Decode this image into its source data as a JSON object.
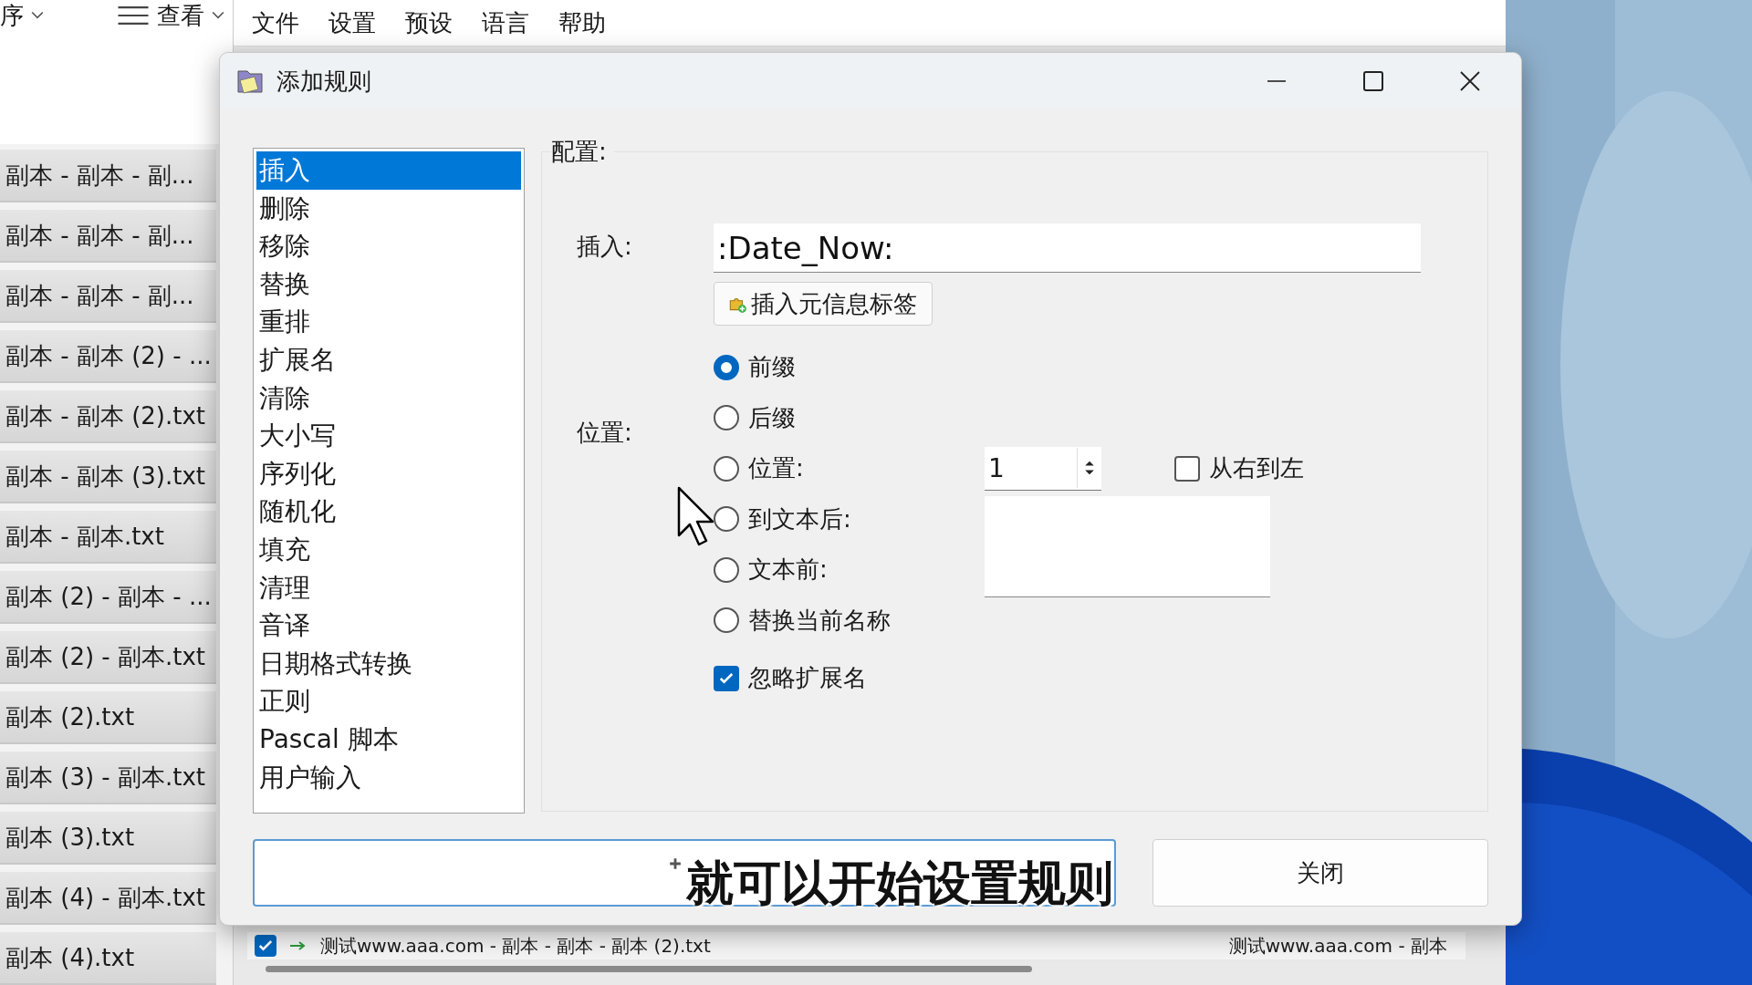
{
  "explorer": {
    "sort_label": "序",
    "view_label": "查看",
    "files": [
      "副本 - 副本 - 副...",
      "副本 - 副本 - 副...",
      "副本 - 副本 - 副...",
      "副本 - 副本 (2) - ...",
      "副本 - 副本 (2).txt",
      "副本 - 副本 (3).txt",
      "副本 - 副本.txt",
      "副本 (2) - 副本 - ...",
      "副本 (2) - 副本.txt",
      "副本 (2).txt",
      "副本 (3) - 副本.txt",
      "副本 (3).txt",
      "副本 (4) - 副本.txt",
      "副本 (4).txt"
    ]
  },
  "menu": [
    "文件",
    "设置",
    "预设",
    "语言",
    "帮助"
  ],
  "dialog": {
    "title": "添加规则",
    "rules": [
      {
        "label": "插入",
        "selected": true
      },
      {
        "label": "删除",
        "selected": false
      },
      {
        "label": "移除",
        "selected": false
      },
      {
        "label": "替换",
        "selected": false
      },
      {
        "label": "重排",
        "selected": false
      },
      {
        "label": "扩展名",
        "selected": false
      },
      {
        "label": "清除",
        "selected": false
      },
      {
        "label": "大小写",
        "selected": false
      },
      {
        "label": "序列化",
        "selected": false
      },
      {
        "label": "随机化",
        "selected": false
      },
      {
        "label": "填充",
        "selected": false
      },
      {
        "label": "清理",
        "selected": false
      },
      {
        "label": "音译",
        "selected": false
      },
      {
        "label": "日期格式转换",
        "selected": false
      },
      {
        "label": "正则",
        "selected": false
      },
      {
        "label": "Pascal 脚本",
        "selected": false
      },
      {
        "label": "用户输入",
        "selected": false
      }
    ],
    "config_label": "配置:",
    "insert_label": "插入:",
    "insert_value": ":Date_Now:",
    "meta_button": "插入元信息标签",
    "position_label": "位置:",
    "options": [
      {
        "kind": "plain",
        "label": "前缀",
        "selected": true
      },
      {
        "kind": "plain",
        "label": "后缀",
        "selected": false
      },
      {
        "kind": "position",
        "label": "位置:",
        "selected": false
      },
      {
        "kind": "after_text",
        "label": "到文本后:",
        "selected": false
      },
      {
        "kind": "before_text",
        "label": "文本前:",
        "selected": false
      },
      {
        "kind": "plain",
        "label": "替换当前名称",
        "selected": false
      }
    ],
    "position_value": "1",
    "right_to_left": {
      "label": "从右到左",
      "checked": false
    },
    "ignore_extension": {
      "label": "忽略扩展名",
      "checked": true
    },
    "close_button": "关闭"
  },
  "file_row": {
    "checked": true,
    "name": "测试www.aaa.com - 副本 - 副本 - 副本 (2).txt",
    "new_name": "测试www.aaa.com - 副本"
  },
  "subtitle": "就可以开始设置规则"
}
